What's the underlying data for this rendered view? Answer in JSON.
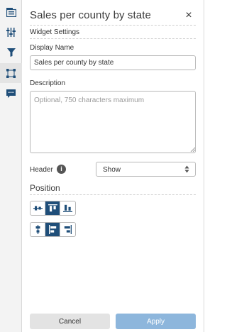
{
  "rail": {
    "items": [
      {
        "icon": "widget-info-icon"
      },
      {
        "icon": "sliders-icon"
      },
      {
        "icon": "filter-icon"
      },
      {
        "icon": "selection-frame-icon",
        "active": true
      },
      {
        "icon": "comment-icon"
      }
    ]
  },
  "panel": {
    "title": "Sales per county by state",
    "close_glyph": "×"
  },
  "widget_settings": {
    "label": "Widget Settings",
    "display_name_label": "Display Name",
    "display_name_value": "Sales per county by state",
    "description_label": "Description",
    "description_placeholder": "Optional, 750 characters maximum",
    "header_label": "Header",
    "info_glyph": "i",
    "header_value": "Show"
  },
  "position": {
    "title": "Position",
    "vertical": [
      {
        "icon": "align-vertical-center-icon",
        "active": false
      },
      {
        "icon": "align-top-icon",
        "active": true
      },
      {
        "icon": "align-bottom-icon",
        "active": false
      }
    ],
    "horizontal": [
      {
        "icon": "align-horizontal-center-icon",
        "active": false
      },
      {
        "icon": "align-left-icon",
        "active": true
      },
      {
        "icon": "align-right-icon",
        "active": false
      }
    ]
  },
  "footer": {
    "cancel_label": "Cancel",
    "apply_label": "Apply"
  },
  "colors": {
    "accent": "#1f4e79",
    "apply_button": "#8db6dc",
    "cancel_button": "#e3e3e3"
  }
}
